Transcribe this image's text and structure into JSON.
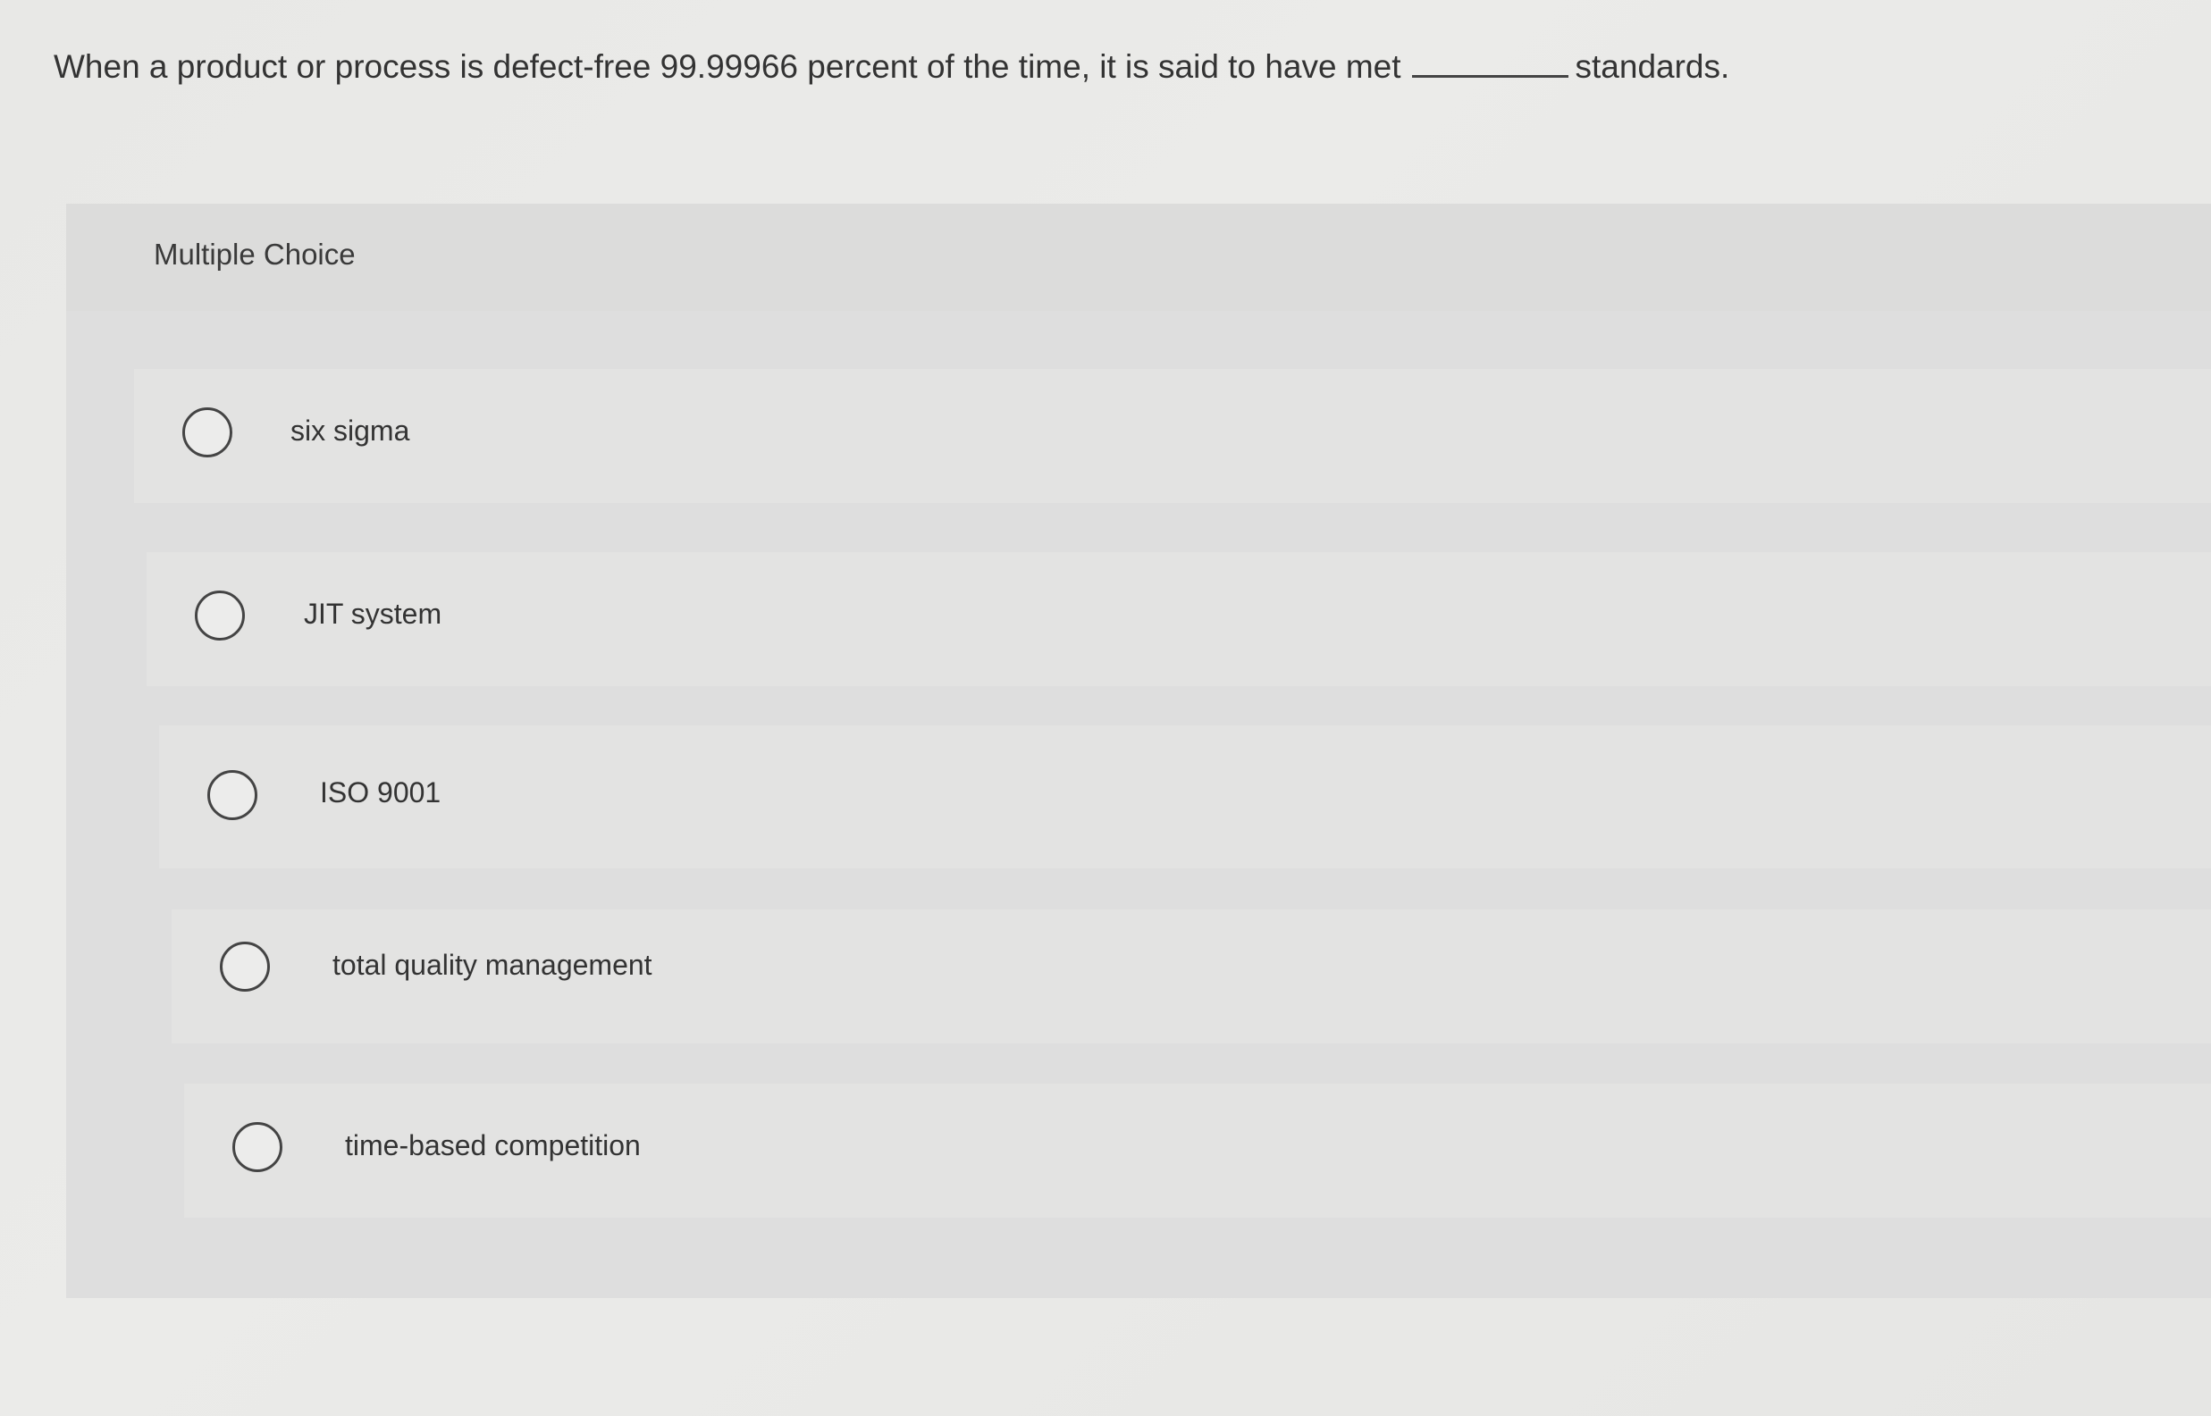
{
  "question": {
    "text_before": "When a product or process is defect-free 99.99966 percent of the time, it is said to have met",
    "text_after": "standards."
  },
  "multiple_choice": {
    "label": "Multiple Choice",
    "options": [
      {
        "label": "six sigma"
      },
      {
        "label": "JIT system"
      },
      {
        "label": "ISO 9001"
      },
      {
        "label": "total quality management"
      },
      {
        "label": "time-based competition"
      }
    ]
  }
}
